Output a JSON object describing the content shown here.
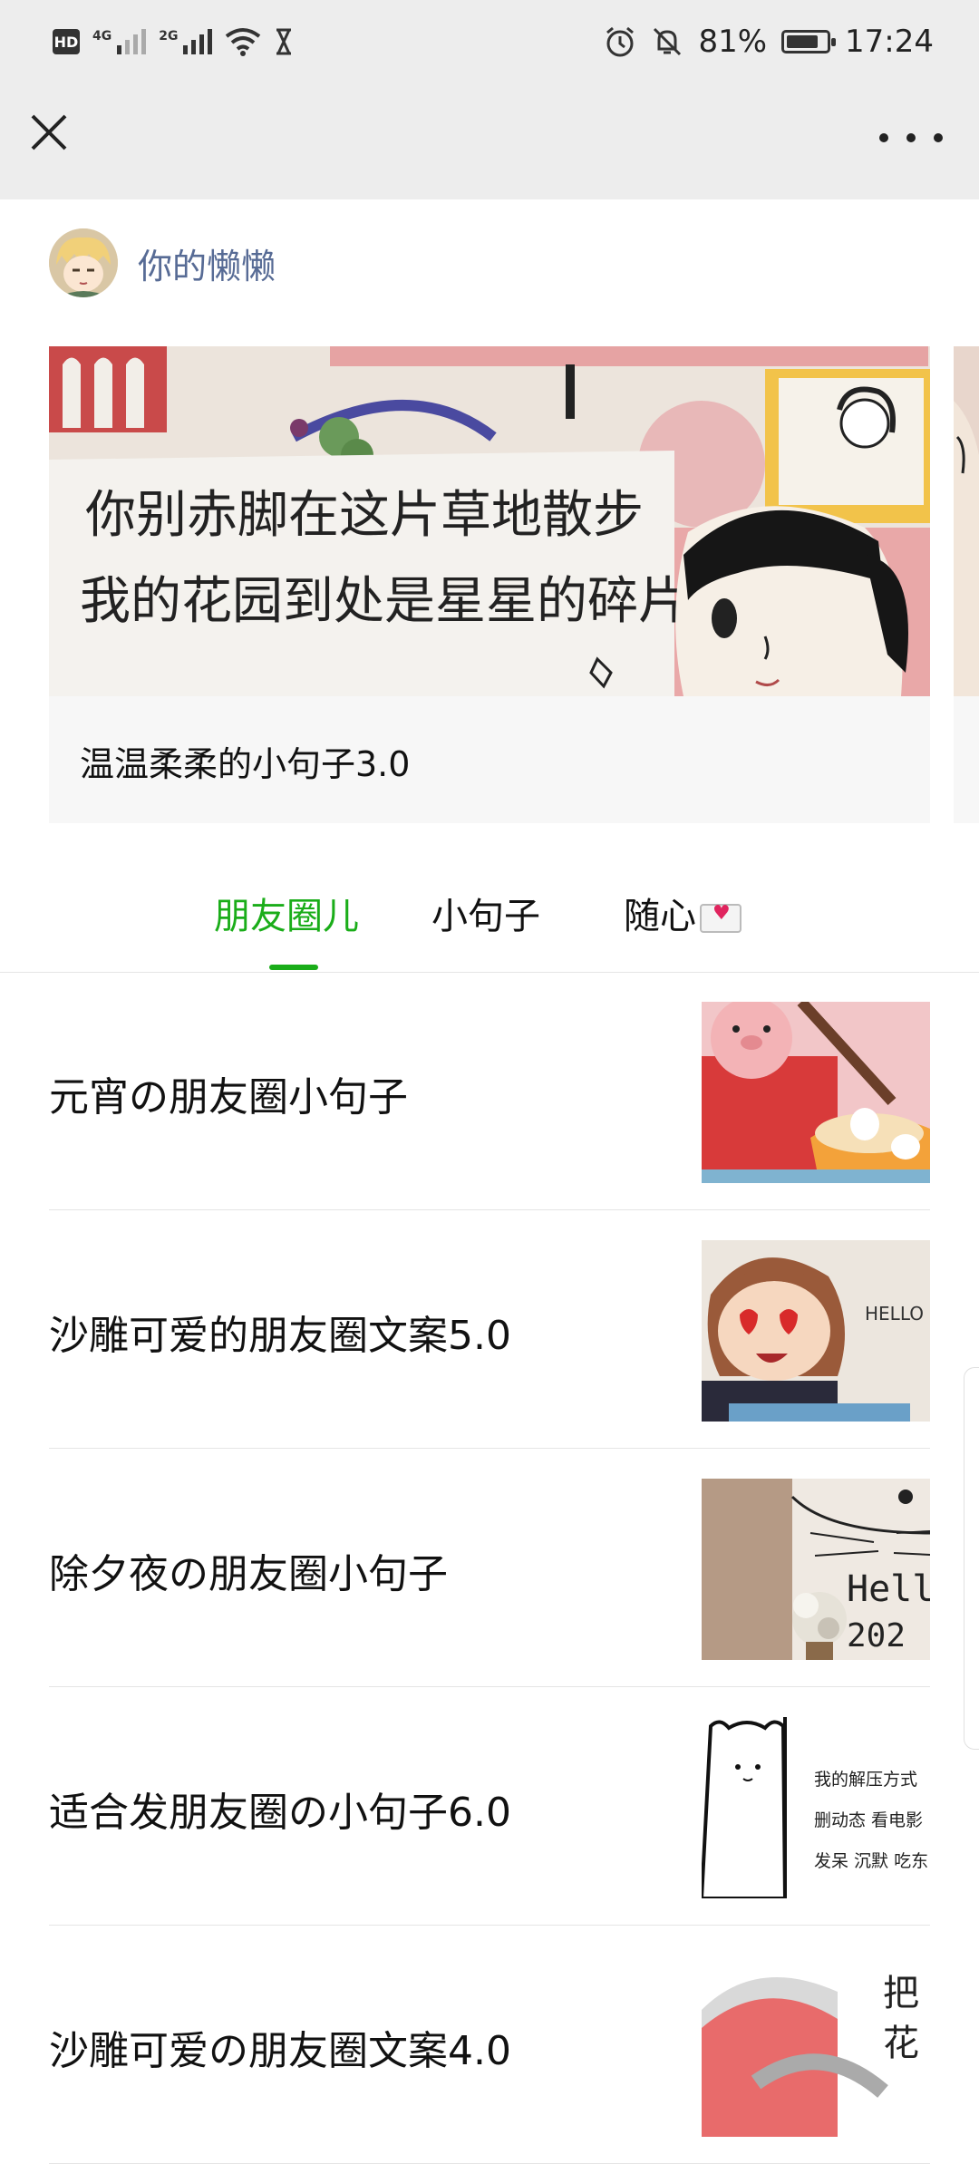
{
  "status_bar": {
    "hd": "HD",
    "net1": "4G",
    "net2": "2G",
    "battery_percent": "81%",
    "battery_level": 0.81,
    "time": "17:24",
    "icons": [
      "wifi-icon",
      "hourglass-icon",
      "alarm-icon",
      "mute-icon",
      "battery-icon"
    ]
  },
  "nav": {
    "close_icon": "close-icon",
    "more_icon": "more-icon"
  },
  "author": {
    "name": "你的懒懒"
  },
  "featured": {
    "image_lines": [
      "你别赤脚在这片草地散步",
      "我的花园到处是星星的碎片"
    ],
    "title": "温温柔柔的小句子3.0"
  },
  "tabs": [
    {
      "label": "朋友圈儿",
      "active": true
    },
    {
      "label": "小句子",
      "active": false
    },
    {
      "label": "随心",
      "active": false
    }
  ],
  "accent_color": "#1aad19",
  "link_color": "#576b95",
  "articles": [
    {
      "title": "元宵の朋友圈小句子"
    },
    {
      "title": "沙雕可爱的朋友圈文案5.0",
      "thumb_text": "HELLO"
    },
    {
      "title": "除夕夜の朋友圈小句子",
      "thumb_text": "Hell",
      "thumb_text2": "202"
    },
    {
      "title": "适合发朋友圈の小句子6.0",
      "thumb_lines": [
        "我的解压方式",
        "删动态 看电影",
        "发呆 沉默 吃东"
      ]
    },
    {
      "title": "沙雕可爱の朋友圈文案4.0",
      "thumb_text": "把",
      "thumb_text2": "花"
    }
  ]
}
